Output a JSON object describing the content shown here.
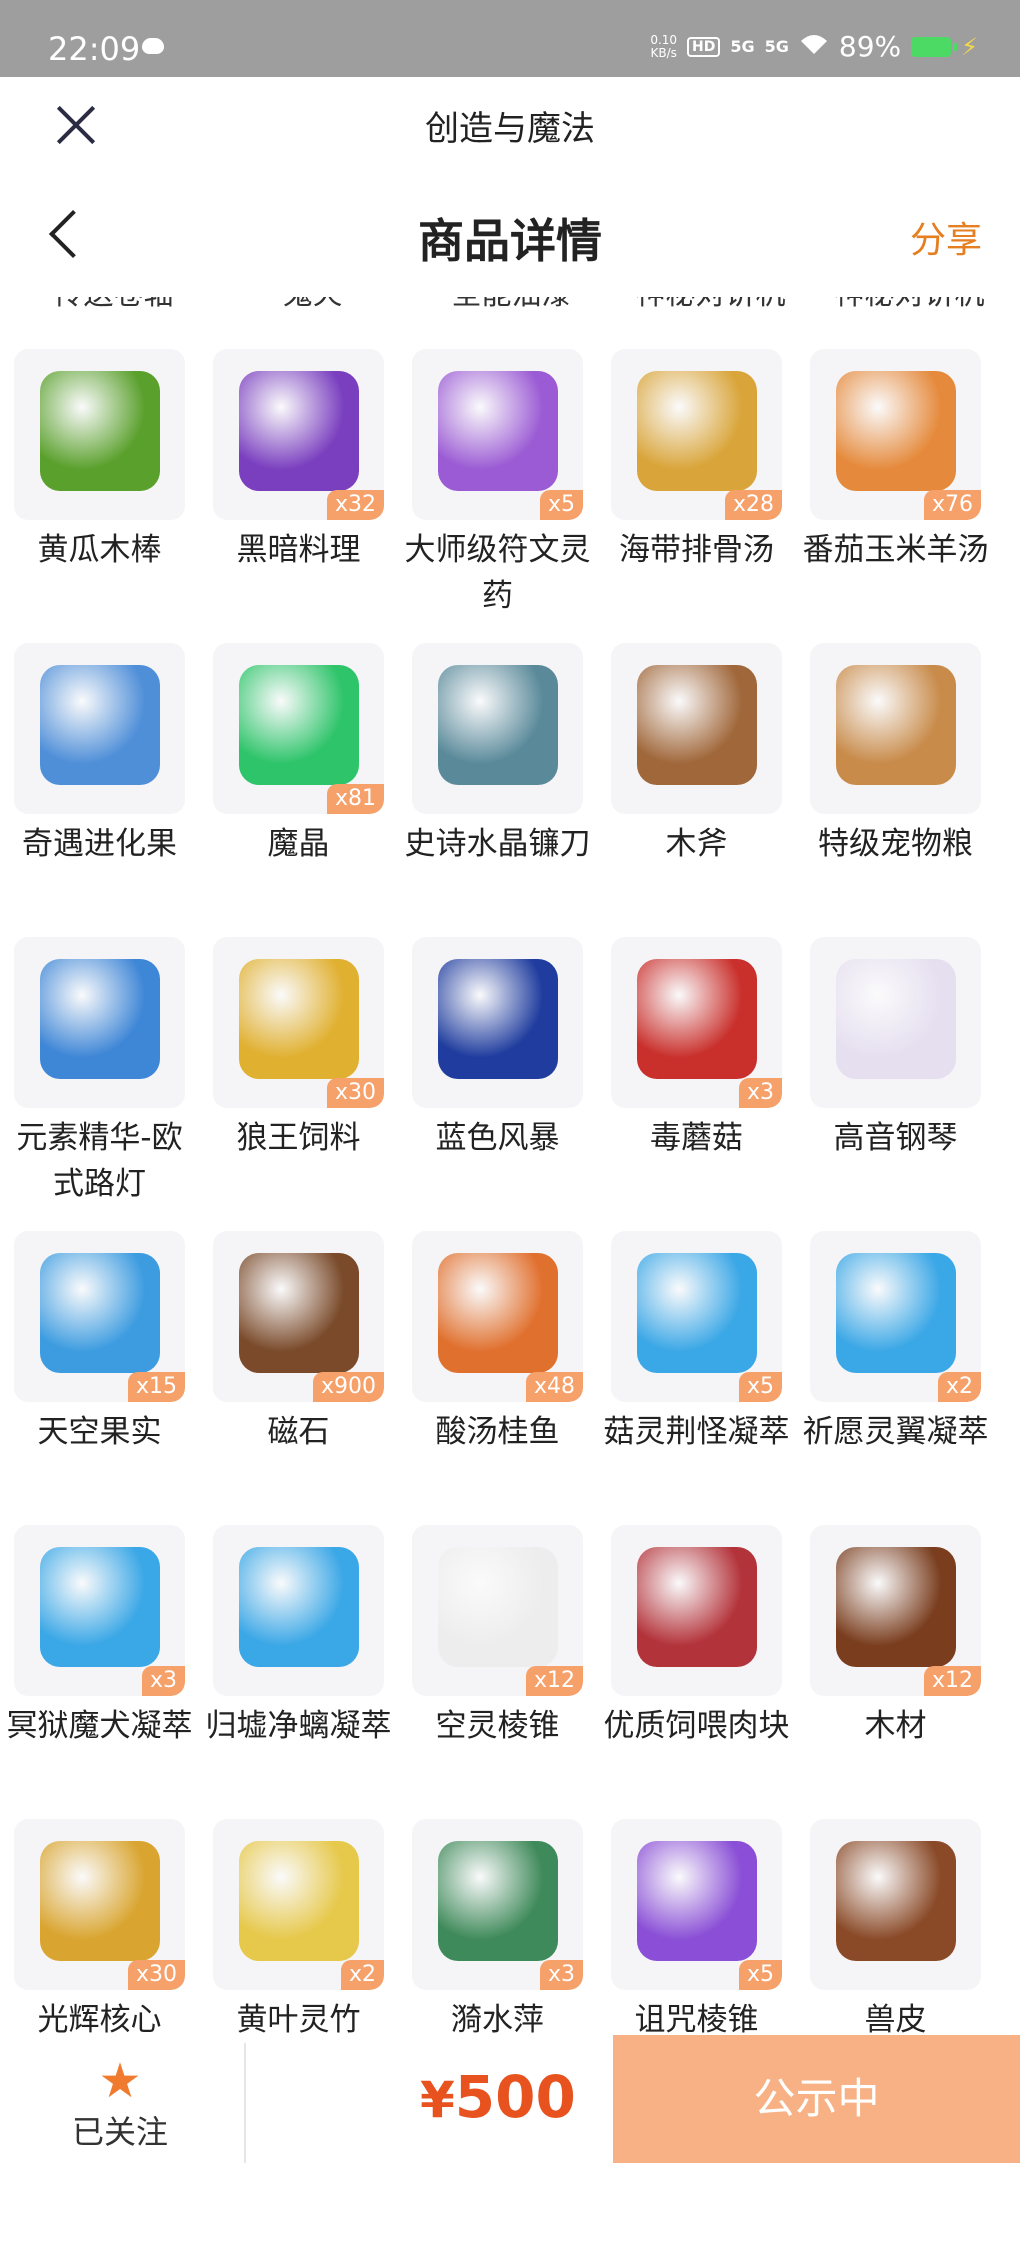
{
  "status_bar": {
    "time": "22:09",
    "net_speed_value": "0.10",
    "net_speed_unit": "KB/s",
    "hd": "HD",
    "signal1": "5G",
    "signal2": "5G",
    "battery": "89%"
  },
  "app": {
    "title": "创造与魔法"
  },
  "header": {
    "title": "商品详情",
    "share": "分享"
  },
  "cut_names": [
    "传送卷轴",
    "鬼火",
    "全能油漆",
    "神秘对讲机",
    "神秘对讲机"
  ],
  "items": [
    {
      "name": "黄瓜木棒",
      "qty": "",
      "color": "#5aa02c"
    },
    {
      "name": "黑暗料理",
      "qty": "x32",
      "color": "#7a3fbf"
    },
    {
      "name": "大师级符文灵药",
      "qty": "x5",
      "color": "#9b5bd4"
    },
    {
      "name": "海带排骨汤",
      "qty": "x28",
      "color": "#d9a53a"
    },
    {
      "name": "番茄玉米羊汤",
      "qty": "x76",
      "color": "#e58a3c"
    },
    {
      "name": "奇遇进化果",
      "qty": "",
      "color": "#4f8fd8"
    },
    {
      "name": "魔晶",
      "qty": "x81",
      "color": "#2ec46a"
    },
    {
      "name": "史诗水晶镰刀",
      "qty": "",
      "color": "#5a8a9a"
    },
    {
      "name": "木斧",
      "qty": "",
      "color": "#a0673a"
    },
    {
      "name": "特级宠物粮",
      "qty": "",
      "color": "#c88b4a"
    },
    {
      "name": "元素精华-欧式路灯",
      "qty": "",
      "color": "#3e86d6"
    },
    {
      "name": "狼王饲料",
      "qty": "x30",
      "color": "#e0b030"
    },
    {
      "name": "蓝色风暴",
      "qty": "",
      "color": "#1f3c9e"
    },
    {
      "name": "毒蘑菇",
      "qty": "x3",
      "color": "#c9302c"
    },
    {
      "name": "高音钢琴",
      "qty": "",
      "color": "#e6dff0"
    },
    {
      "name": "天空果实",
      "qty": "x15",
      "color": "#3d9ce0"
    },
    {
      "name": "磁石",
      "qty": "x900",
      "color": "#7a4a2a"
    },
    {
      "name": "酸汤桂鱼",
      "qty": "x48",
      "color": "#e0702e"
    },
    {
      "name": "菇灵荆怪凝萃",
      "qty": "x5",
      "color": "#3aa7e6"
    },
    {
      "name": "祈愿灵翼凝萃",
      "qty": "x2",
      "color": "#3aa7e6"
    },
    {
      "name": "冥狱魔犬凝萃",
      "qty": "x3",
      "color": "#3aa7e6"
    },
    {
      "name": "归墟净螭凝萃",
      "qty": "",
      "color": "#3aa7e6"
    },
    {
      "name": "空灵棱锥",
      "qty": "x12",
      "color": "#ededed"
    },
    {
      "name": "优质饲喂肉块",
      "qty": "",
      "color": "#b3333a"
    },
    {
      "name": "木材",
      "qty": "x12",
      "color": "#7a3e1f"
    },
    {
      "name": "光辉核心",
      "qty": "x30",
      "color": "#d9a530"
    },
    {
      "name": "黄叶灵竹",
      "qty": "x2",
      "color": "#e6c84a"
    },
    {
      "name": "漪水萍",
      "qty": "x3",
      "color": "#3f8a5a"
    },
    {
      "name": "诅咒棱锥",
      "qty": "x5",
      "color": "#8a4fd6"
    },
    {
      "name": "兽皮",
      "qty": "",
      "color": "#8a4a28"
    }
  ],
  "bottom_bar": {
    "follow_label": "已关注",
    "price_currency": "¥",
    "price_value": "500",
    "status_button": "公示中"
  }
}
